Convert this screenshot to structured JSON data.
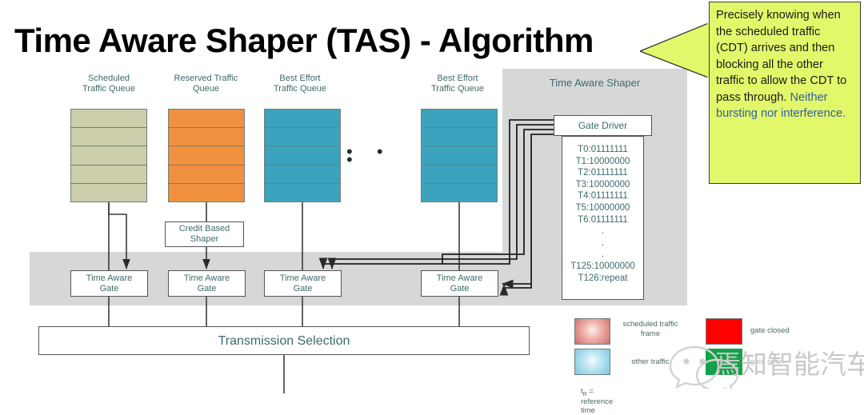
{
  "title": "Time Aware Shaper (TAS) - Algorithm",
  "shaper": {
    "panel_label": "Time Aware Shaper",
    "gate_driver_label": "Gate Driver",
    "schedule": "T0:01111111\nT1:10000000\nT2:01111111\nT3:10000000\nT4:01111111\nT5:10000000\nT6:01111111\n.\n.\n.\nT125:10000000\nT126:repeat"
  },
  "queues": [
    {
      "label": "Scheduled\nTraffic Queue",
      "color": "#ccceac",
      "cells": 5
    },
    {
      "label": "Reserved Traffic\nQueue",
      "color": "#f0913f",
      "cells": 5
    },
    {
      "label": "Best Effort\nTraffic Queue",
      "color": "#3ba3bd",
      "cells": 5
    },
    {
      "label": "Best Effort\nTraffic Queue",
      "color": "#3ba3bd",
      "cells": 5
    }
  ],
  "ellipsis": "• • •",
  "blocks": {
    "credit_based_shaper": "Credit Based\nShaper",
    "time_aware_gate": "Time Aware\nGate",
    "transmission_selection": "Transmission Selection"
  },
  "callout": {
    "black_text": "Precisely knowing when the scheduled traffic (CDT) arrives and then blocking all the other traffic to allow the CDT to pass through.",
    "blue_text": "Neither bursting nor interference.",
    "bg_color": "#e3f76a",
    "blue_color": "#2e5fa3"
  },
  "legend": {
    "scheduled_traffic_frame": "scheduled traffic\nframe",
    "other_traffic": "other traffic",
    "gate_closed": "gate closed",
    "gate_open": "gate open",
    "reference_time_prefix": "t",
    "reference_time_sub": "R",
    "reference_time_rest": " = reference time",
    "closed_color": "#ff0000",
    "open_color": "#15a04a"
  },
  "watermark": {
    "text": "焉知智能汽车",
    "icon": "wechat-icon"
  }
}
